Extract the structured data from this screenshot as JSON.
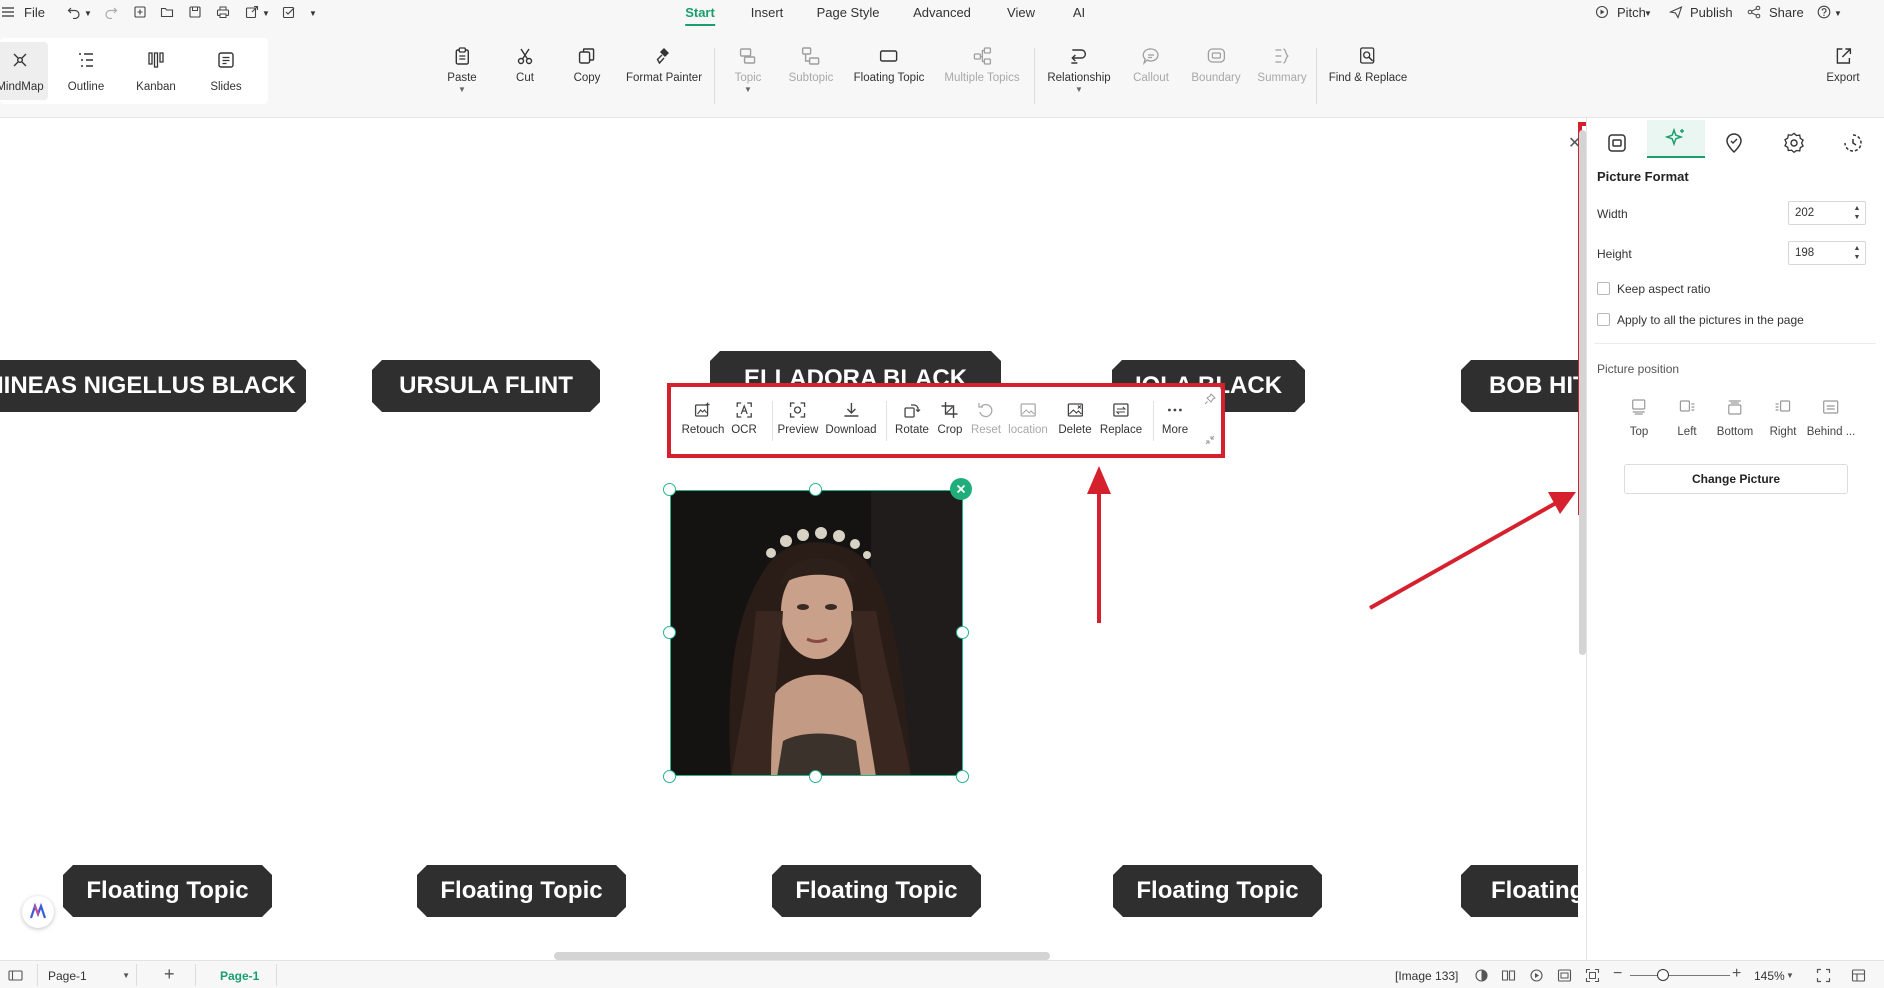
{
  "menubar": {
    "file": "File",
    "tabs": [
      "Start",
      "Insert",
      "Page Style",
      "Advanced",
      "View",
      "AI"
    ],
    "active_tab": "Start",
    "pitch": "Pitch",
    "publish": "Publish",
    "share": "Share"
  },
  "views": [
    "MindMap",
    "Outline",
    "Kanban",
    "Slides"
  ],
  "ribbon": {
    "paste": "Paste",
    "cut": "Cut",
    "copy": "Copy",
    "format_painter": "Format Painter",
    "topic": "Topic",
    "subtopic": "Subtopic",
    "floating_topic": "Floating Topic",
    "multiple_topics": "Multiple Topics",
    "relationship": "Relationship",
    "callout": "Callout",
    "boundary": "Boundary",
    "summary": "Summary",
    "find_replace": "Find & Replace",
    "export": "Export"
  },
  "canvas": {
    "top_topics": [
      "PHINEAS NIGELLUS BLACK",
      "URSULA  FLINT",
      "ELLADORA  BLACK",
      "IOLA BLACK",
      "BOB HITCHENS"
    ],
    "bottom_topics": [
      "Floating Topic",
      "Floating Topic",
      "Floating Topic",
      "Floating Topic",
      "Floating Topic"
    ]
  },
  "picture_toolbar": {
    "retouch": "Retouch",
    "ocr": "OCR",
    "preview": "Preview",
    "download": "Download",
    "rotate": "Rotate",
    "crop": "Crop",
    "reset": "Reset",
    "location": "location",
    "delete": "Delete",
    "replace": "Replace",
    "more": "More"
  },
  "panel": {
    "title": "Picture Format",
    "width_label": "Width",
    "width_value": "202",
    "height_label": "Height",
    "height_value": "198",
    "keep_aspect": "Keep aspect ratio",
    "apply_all": "Apply to all the pictures in the page",
    "position_label": "Picture position",
    "positions": [
      "Top",
      "Left",
      "Bottom",
      "Right",
      "Behind ..."
    ],
    "change_picture": "Change Picture"
  },
  "statusbar": {
    "page_selector": "Page-1",
    "page_tab": "Page-1",
    "selection": "[Image 133]",
    "zoom": "145%"
  },
  "colors": {
    "accent": "#1a9e6e",
    "annotation": "#d5202e",
    "topic_bg": "#2f2f2f"
  }
}
